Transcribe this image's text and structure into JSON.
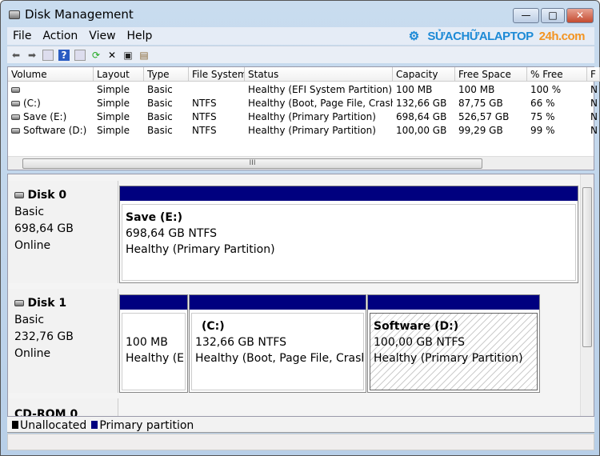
{
  "window": {
    "title": "Disk Management",
    "minimize": "—",
    "maximize": "□",
    "close": "✕"
  },
  "menu": [
    "File",
    "Action",
    "View",
    "Help"
  ],
  "watermark": {
    "main": "SỬACHỮALAPTOP",
    "accent": "24h.com"
  },
  "toolbar": [
    "back-icon",
    "forward-icon",
    "console-tree-icon",
    "help-icon",
    "action-pane-icon",
    "refresh-icon",
    "delete-icon",
    "properties-icon",
    "rescan-icon"
  ],
  "columns": [
    "Volume",
    "Layout",
    "Type",
    "File System",
    "Status",
    "Capacity",
    "Free Space",
    "% Free",
    "F"
  ],
  "rows": [
    [
      "",
      "Simple",
      "Basic",
      "",
      "Healthy (EFI System Partition)",
      "100 MB",
      "100 MB",
      "100 %",
      "N"
    ],
    [
      "(C:)",
      "Simple",
      "Basic",
      "NTFS",
      "Healthy (Boot, Page File, Crash...",
      "132,66 GB",
      "87,75 GB",
      "66 %",
      "N"
    ],
    [
      "Save (E:)",
      "Simple",
      "Basic",
      "NTFS",
      "Healthy (Primary Partition)",
      "698,64 GB",
      "526,57 GB",
      "75 %",
      "N"
    ],
    [
      "Software (D:)",
      "Simple",
      "Basic",
      "NTFS",
      "Healthy (Primary Partition)",
      "100,00 GB",
      "99,29 GB",
      "99 %",
      "N"
    ]
  ],
  "scroll_thumb": "III",
  "disks": [
    {
      "name": "Disk 0",
      "type": "Basic",
      "size": "698,64 GB",
      "state": "Online",
      "partitions": [
        {
          "name": "Save  (E:)",
          "size": "698,64 GB NTFS",
          "status": "Healthy (Primary Partition)"
        }
      ]
    },
    {
      "name": "Disk 1",
      "type": "Basic",
      "size": "232,76 GB",
      "state": "Online",
      "partitions": [
        {
          "name": "",
          "size": "100 MB",
          "status": "Healthy (EFI System Partition)"
        },
        {
          "name": "(C:)",
          "size": "132,66 GB NTFS",
          "status": "Healthy (Boot, Page File, Crash Dump, Primary Partition)"
        },
        {
          "name": "Software  (D:)",
          "size": "100,00 GB NTFS",
          "status": "Healthy (Primary Partition)"
        }
      ]
    },
    {
      "name": "CD-ROM 0"
    }
  ],
  "legend": [
    {
      "label": "Unallocated",
      "color": "#000000"
    },
    {
      "label": "Primary partition",
      "color": "#00007f"
    }
  ]
}
